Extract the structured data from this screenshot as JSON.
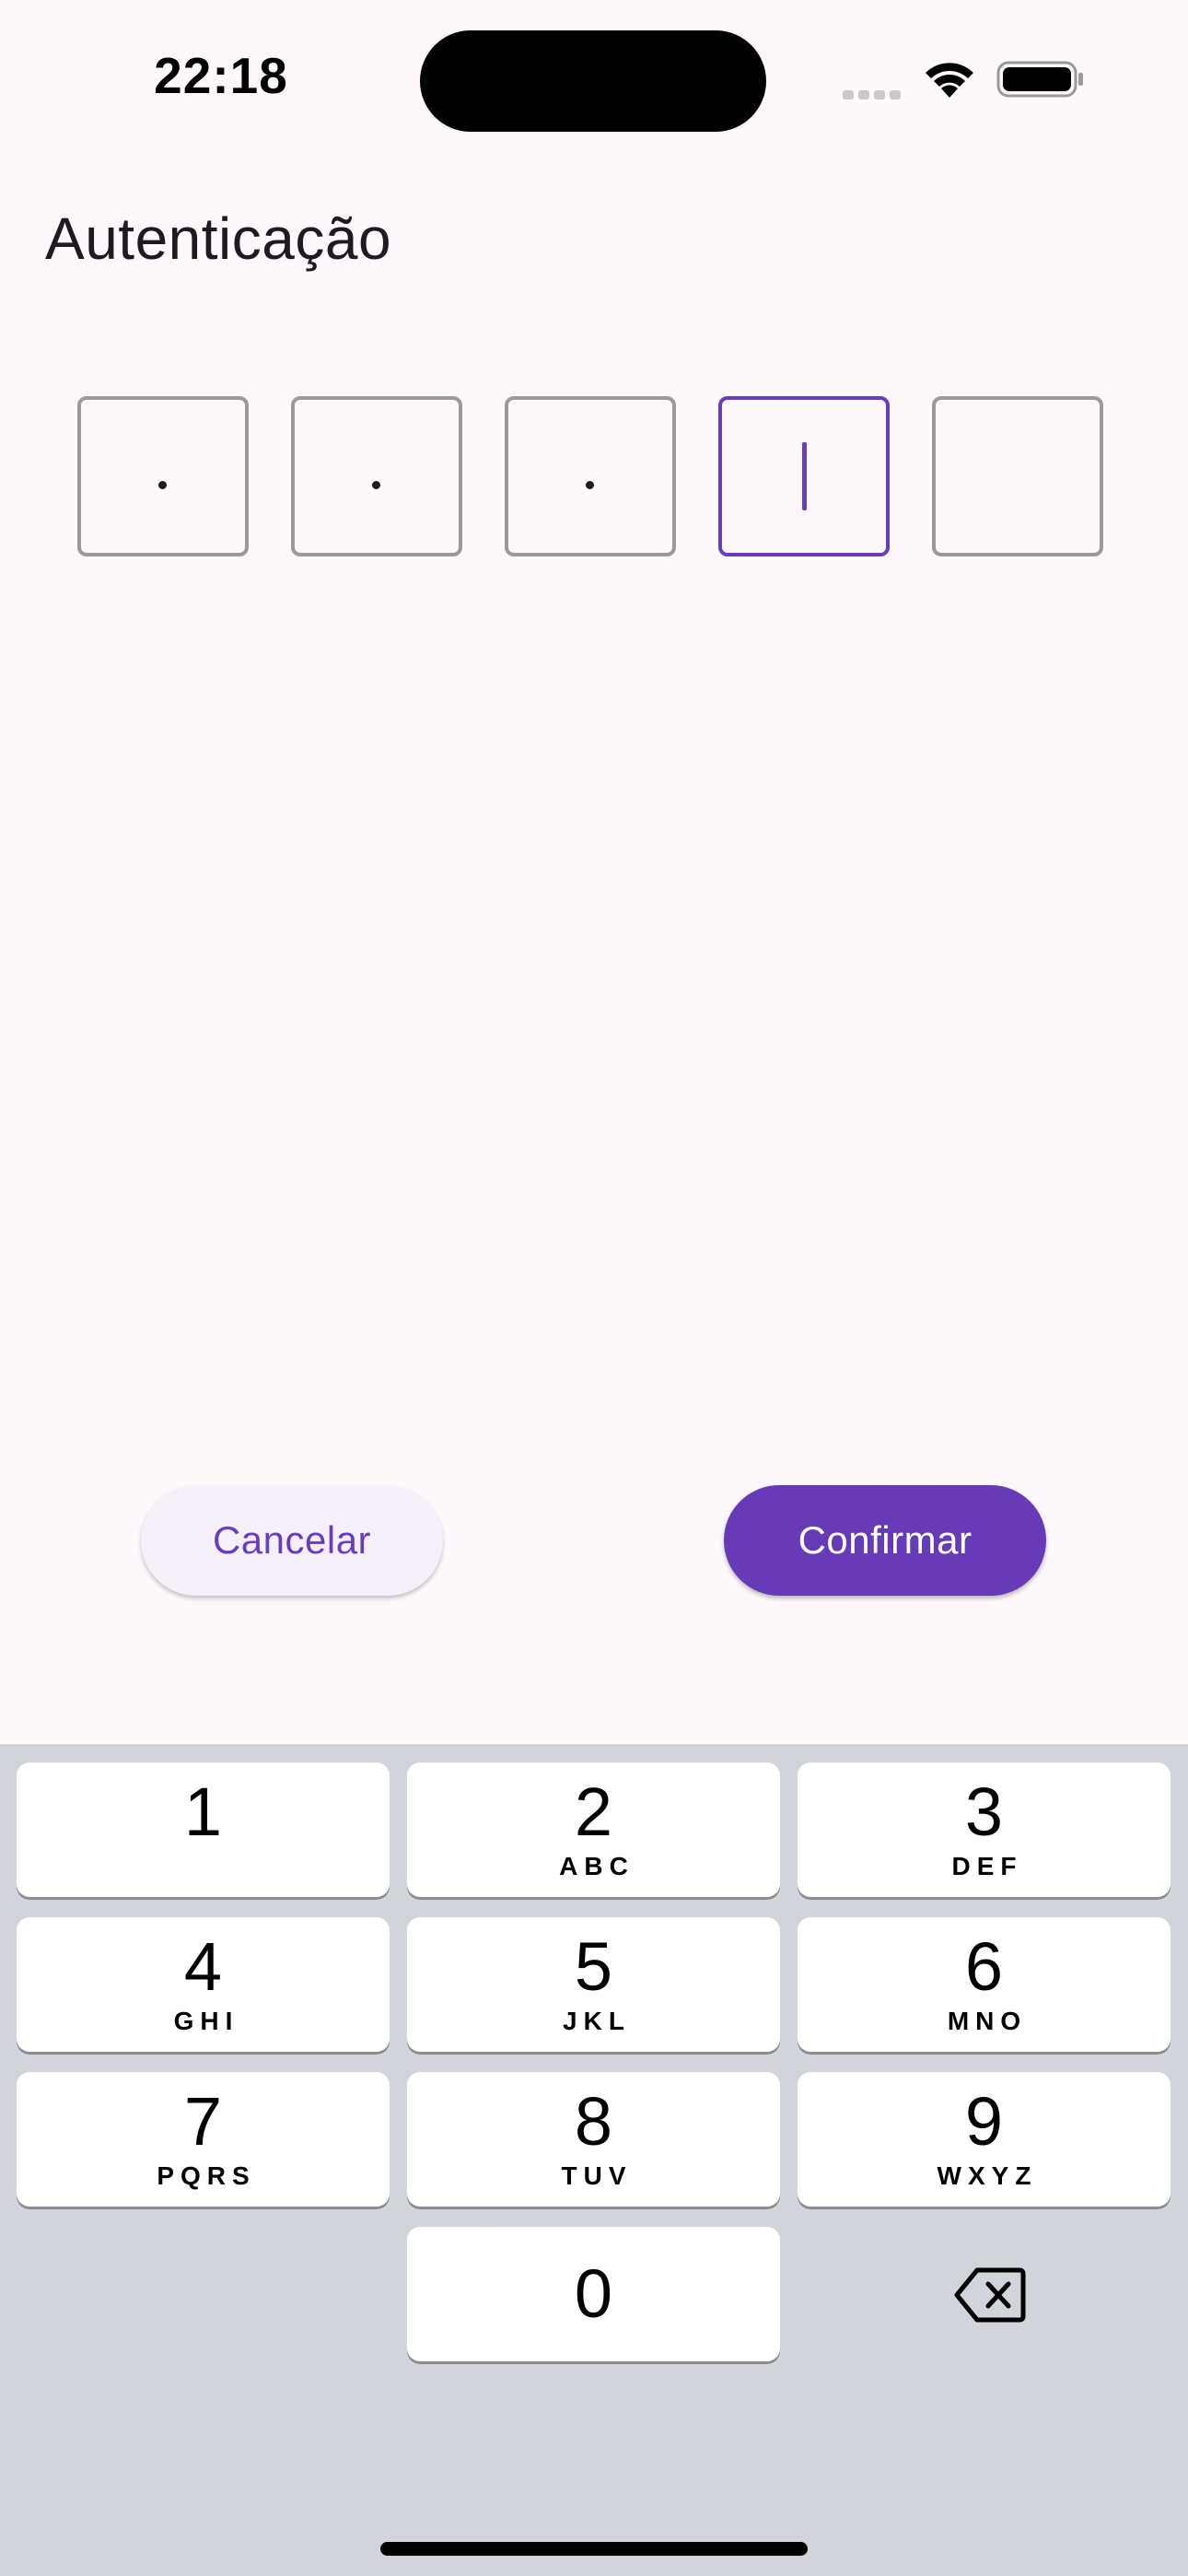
{
  "status_bar": {
    "time": "22:18"
  },
  "page": {
    "title": "Autenticação"
  },
  "pin": {
    "length": 5,
    "filled": 3,
    "active_index": 3
  },
  "actions": {
    "cancel_label": "Cancelar",
    "confirm_label": "Confirmar"
  },
  "keyboard": {
    "keys": [
      {
        "digit": "1",
        "letters": ""
      },
      {
        "digit": "2",
        "letters": "ABC"
      },
      {
        "digit": "3",
        "letters": "DEF"
      },
      {
        "digit": "4",
        "letters": "GHI"
      },
      {
        "digit": "5",
        "letters": "JKL"
      },
      {
        "digit": "6",
        "letters": "MNO"
      },
      {
        "digit": "7",
        "letters": "PQRS"
      },
      {
        "digit": "8",
        "letters": "TUV"
      },
      {
        "digit": "9",
        "letters": "WXYZ"
      },
      {
        "digit": "0",
        "letters": ""
      }
    ],
    "delete_icon": "backspace-icon"
  },
  "colors": {
    "accent": "#673ab7",
    "background": "#fef7fb",
    "keyboard_background": "#d1d4da"
  }
}
